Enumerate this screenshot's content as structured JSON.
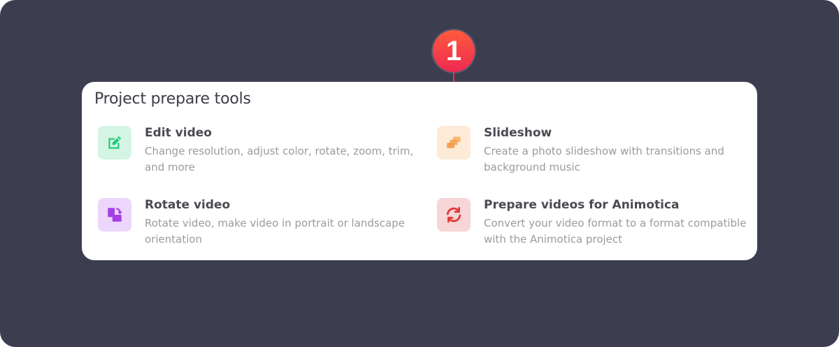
{
  "callout": {
    "number": "1"
  },
  "card": {
    "title": "Project prepare tools",
    "tools": [
      {
        "name": "Edit video",
        "description": "Change resolution, adjust color, rotate, zoom, trim, and more",
        "icon": "edit-icon",
        "icon_bg": "#d4f5e4",
        "icon_color": "#1fc97a"
      },
      {
        "name": "Slideshow",
        "description": "Create a photo slideshow with transitions and background music",
        "icon": "slides-icon",
        "icon_bg": "#fdebd8",
        "icon_color": "#f5a04d"
      },
      {
        "name": "Rotate video",
        "description": "Rotate video, make video in portrait or landscape orientation",
        "icon": "rotate-icon",
        "icon_bg": "#ecd6fb",
        "icon_color": "#a73de6"
      },
      {
        "name": "Prepare videos for Animotica",
        "description": "Convert your video format to a format compatible with the Animotica project",
        "icon": "convert-icon",
        "icon_bg": "#f6d6d6",
        "icon_color": "#e03a3a"
      }
    ]
  }
}
